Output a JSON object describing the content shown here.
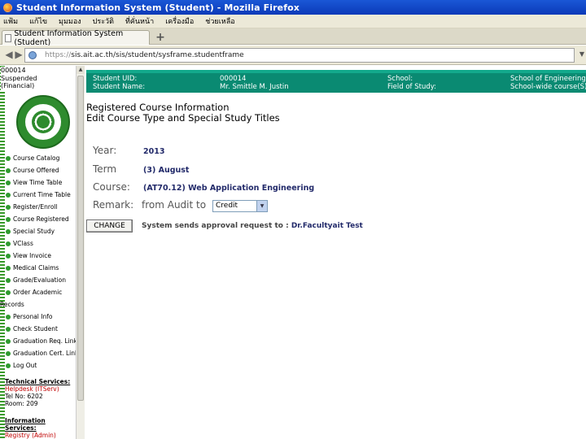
{
  "window": {
    "title": "Student Information System (Student) - Mozilla Firefox"
  },
  "menubar": {
    "items": [
      "แฟ้ม",
      "แก้ไข",
      "มุมมอง",
      "ประวัติ",
      "ที่คั่นหน้า",
      "เครื่องมือ",
      "ช่วยเหลือ"
    ]
  },
  "tabs": [
    {
      "label": "Student Information System (Student)"
    }
  ],
  "newtab_label": "+",
  "navbar": {
    "url_prefix": "https://",
    "url": "sis.ait.ac.th/sis/student/sysframe.studentframe"
  },
  "sidebar": {
    "student_id": "000014",
    "status_line1": "Suspended",
    "status_line2": "(Financial)",
    "menu": [
      {
        "label": "Course Catalog",
        "dot": true
      },
      {
        "label": "Course Offered",
        "dot": true
      },
      {
        "label": "View Time Table",
        "dot": true
      },
      {
        "label": "Current Time Table",
        "dot": true
      },
      {
        "label": "Register/Enroll",
        "dot": true
      },
      {
        "label": "Course Registered",
        "dot": true
      },
      {
        "label": "Special Study",
        "dot": true
      },
      {
        "label": "VClass",
        "dot": true
      },
      {
        "label": "View Invoice",
        "dot": true
      },
      {
        "label": "Medical Claims",
        "dot": true
      },
      {
        "label": "Grade/Evaluation",
        "dot": true
      },
      {
        "label": "Order Academic",
        "dot": true
      },
      {
        "label": "Records",
        "dot": false
      },
      {
        "label": "Personal Info",
        "dot": true
      },
      {
        "label": "Check Student",
        "dot": true
      },
      {
        "label": "Graduation Req. Link",
        "dot": true
      },
      {
        "label": "Graduation Cert. Link",
        "dot": true
      },
      {
        "label": "Log Out",
        "dot": true
      }
    ],
    "tech_heading": "Technical Services:",
    "tech_link": "Helpdesk (ITServ)",
    "tech_tel": "Tel No: 6202",
    "tech_room": "Room: 209",
    "info_heading1": "Information",
    "info_heading2": "Services:",
    "info_link": "Registry (Admin)"
  },
  "infoband": {
    "student_uid_label": "Student UID:",
    "student_uid": "000014",
    "student_name_label": "Student Name:",
    "student_name": "Mr. Smittle M. Justin",
    "school_label": "School:",
    "school": "School of Engineering",
    "field_label": "Field of Study:",
    "field": "School-wide course(S)"
  },
  "main": {
    "title_line1": "Registered Course Information",
    "title_line2": "Edit Course Type and Special Study Titles",
    "year_label": "Year:",
    "year": "2013",
    "term_label": "Term",
    "term": "(3) August",
    "course_label": "Course:",
    "course": "(AT70.12) Web Application Engineering",
    "remark_label": "Remark:",
    "remark_mid": "from Audit to",
    "remark_select": "Credit",
    "change_button": "CHANGE",
    "approval_text": "System sends approval request to : ",
    "approval_name": "Dr.Facultyait Test"
  }
}
